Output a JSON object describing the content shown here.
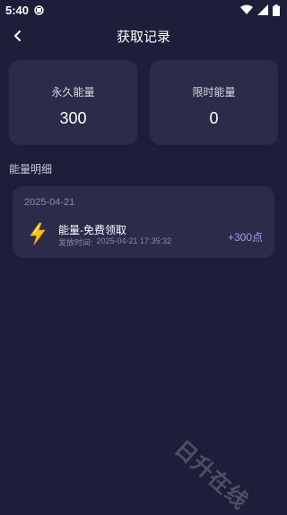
{
  "status_bar": {
    "time": "5:40"
  },
  "header": {
    "title": "获取记录"
  },
  "stats": {
    "permanent_label": "永久能量",
    "permanent_value": "300",
    "limited_label": "限时能量",
    "limited_value": "0"
  },
  "section": {
    "title": "能量明细"
  },
  "records": [
    {
      "date": "2025-04-21",
      "name": "能量-免费领取",
      "time_label": "发放时间:",
      "time_value": "2025-04-21 17:35:32",
      "amount": "+300点",
      "icon": "lightning-bolt-icon"
    }
  ],
  "watermark": "日升在线",
  "colors": {
    "background": "#1e1d3a",
    "card": "#2c2b4a",
    "accent": "#a59cf0",
    "bolt": "#f5c518"
  }
}
